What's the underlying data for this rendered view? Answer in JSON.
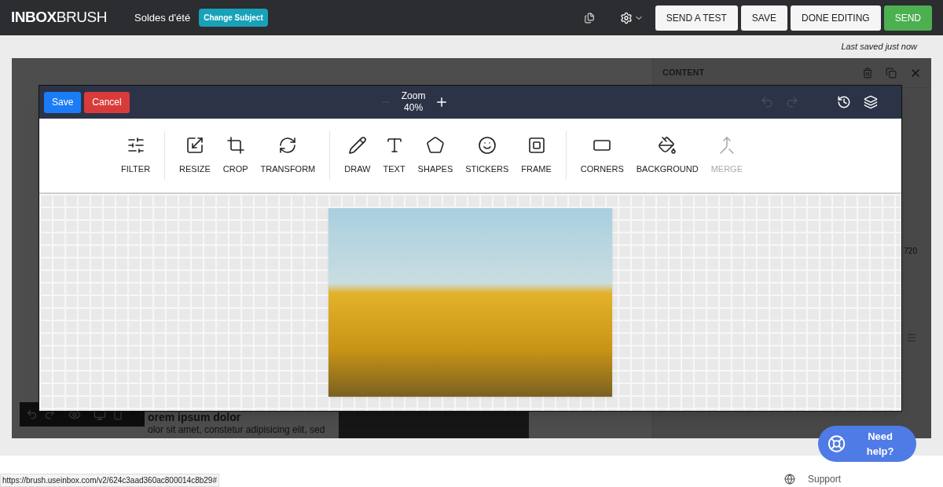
{
  "top_bar": {
    "logo": "**INBOX**BRUSH",
    "subject": "Soldes d'été",
    "change_subject": "Change Subject",
    "buttons": [
      {
        "label": "SEND A TEST",
        "kind": "plain"
      },
      {
        "label": "SAVE",
        "kind": "plain"
      },
      {
        "label": "DONE EDITING",
        "kind": "plain"
      },
      {
        "label": "SEND",
        "kind": "primary"
      }
    ]
  },
  "status": "Last saved just now",
  "side_panel": {
    "title": "CONTENT",
    "dimension": "720"
  },
  "email_preview": {
    "heading": "orem ipsum dolor",
    "body": "olor sit amet, constetur adipisicing elit, sed"
  },
  "image_editor": {
    "save": "Save",
    "cancel": "Cancel",
    "zoom_label": "Zoom",
    "zoom_value": "40%",
    "zoom_out_disabled": true,
    "undo_disabled": true,
    "redo_disabled": true,
    "tool_groups": [
      [
        {
          "label": "FILTER",
          "disabled": false
        }
      ],
      [
        {
          "label": "RESIZE",
          "disabled": false
        },
        {
          "label": "CROP",
          "disabled": false
        },
        {
          "label": "TRANSFORM",
          "disabled": false
        }
      ],
      [
        {
          "label": "DRAW",
          "disabled": false
        },
        {
          "label": "TEXT",
          "disabled": false
        },
        {
          "label": "SHAPES",
          "disabled": false
        },
        {
          "label": "STICKERS",
          "disabled": false
        },
        {
          "label": "FRAME",
          "disabled": false
        }
      ],
      [
        {
          "label": "CORNERS",
          "disabled": false
        },
        {
          "label": "BACKGROUND",
          "disabled": false
        },
        {
          "label": "MERGE",
          "disabled": true
        }
      ]
    ]
  },
  "help_button": "Need help?",
  "support_link": "Support",
  "url_status": "https://brush.useinbox.com/v2/624c3aad360ac800014c8b29#"
}
